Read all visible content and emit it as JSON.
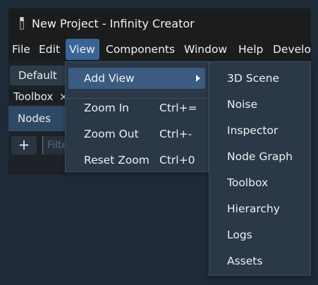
{
  "window": {
    "title": "New Project - Infinity Creator"
  },
  "menubar": {
    "items": [
      {
        "label": "File"
      },
      {
        "label": "Edit"
      },
      {
        "label": "View"
      },
      {
        "label": "Components"
      },
      {
        "label": "Window"
      },
      {
        "label": "Help"
      },
      {
        "label": "Develo"
      }
    ],
    "active": "View"
  },
  "panel": {
    "layout_select": "Default",
    "tab_label": "Toolbox",
    "tab_close": "×",
    "selected_item": "Nodes",
    "add_button": "+",
    "filter_placeholder": "Filter"
  },
  "view_menu": {
    "items": [
      {
        "label": "Add View",
        "shortcut": "",
        "has_submenu": true
      },
      {
        "label": "Zoom In",
        "shortcut": "Ctrl+="
      },
      {
        "label": "Zoom Out",
        "shortcut": "Ctrl+-"
      },
      {
        "label": "Reset Zoom",
        "shortcut": "Ctrl+0"
      }
    ]
  },
  "add_view_submenu": {
    "items": [
      "3D Scene",
      "Noise",
      "Inspector",
      "Node Graph",
      "Toolbox",
      "Hierarchy",
      "Logs",
      "Assets"
    ]
  },
  "colors": {
    "accent": "#3b6496",
    "menu_bg": "#2a3847",
    "bar_bg": "#1b1c1e"
  }
}
